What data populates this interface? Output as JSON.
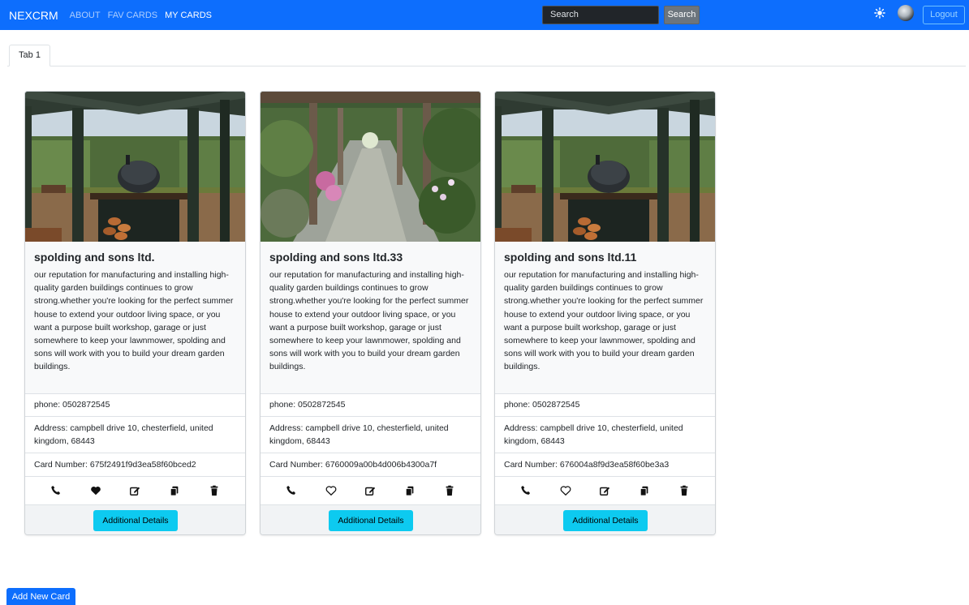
{
  "navbar": {
    "brand": "NEXCRM",
    "links": [
      "ABOUT",
      "FAV CARDS",
      "MY CARDS"
    ],
    "search_placeholder": "Search",
    "search_button": "Search",
    "logout_label": "Logout",
    "colors": {
      "background": "#0d6efd",
      "search_bg": "#212529",
      "search_button_bg": "#6c757d"
    }
  },
  "tabs": [
    {
      "label": "Tab 1"
    }
  ],
  "cards": [
    {
      "title": "spolding and sons ltd.",
      "description": "our reputation for manufacturing and installing high-quality garden buildings continues to grow strong.whether you're looking for the perfect summer house to extend your outdoor living space, or you want a purpose built workshop, garage or just somewhere to keep your lawnmower, spolding and sons will work with you to build your dream garden buildings.",
      "phone": "phone: 0502872545",
      "address": "Address: campbell drive 10, chesterfield, united kingdom, 68443",
      "card_number": "Card Number: 675f2491f9d3ea58f60bced2",
      "favorited": true,
      "image": "pergola-pizza-oven",
      "details_label": "Additional Details"
    },
    {
      "title": "spolding and sons ltd.33",
      "description": "our reputation for manufacturing and installing high-quality garden buildings continues to grow strong.whether you're looking for the perfect summer house to extend your outdoor living space, or you want a purpose built workshop, garage or just somewhere to keep your lawnmower, spolding and sons will work with you to build your dream garden buildings.",
      "phone": "phone: 0502872545",
      "address": "Address: campbell drive 10, chesterfield, united kingdom, 68443",
      "card_number": "Card Number: 6760009a00b4d006b4300a7f",
      "favorited": false,
      "image": "garden-pergola-path",
      "details_label": "Additional Details"
    },
    {
      "title": "spolding and sons ltd.11",
      "description": "our reputation for manufacturing and installing high-quality garden buildings continues to grow strong.whether you're looking for the perfect summer house to extend your outdoor living space, or you want a purpose built workshop, garage or just somewhere to keep your lawnmower, spolding and sons will work with you to build your dream garden buildings.",
      "phone": "phone: 0502872545",
      "address": "Address: campbell drive 10, chesterfield, united kingdom, 68443",
      "card_number": "Card Number: 676004a8f9d3ea58f60be3a3",
      "favorited": false,
      "image": "pergola-pizza-oven",
      "details_label": "Additional Details"
    }
  ],
  "card_icons": [
    "phone-icon",
    "heart-icon",
    "edit-icon",
    "copy-icon",
    "trash-icon"
  ],
  "add_button": "Add New Card",
  "accent_colors": {
    "info_button": "#0dcaf0",
    "primary": "#0d6efd"
  }
}
